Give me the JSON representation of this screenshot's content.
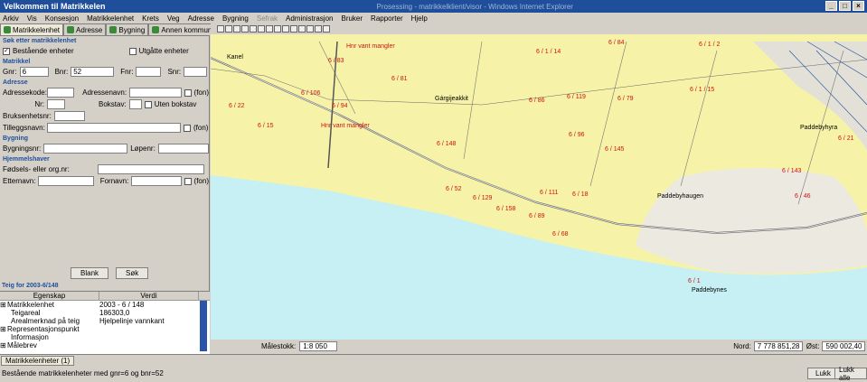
{
  "window": {
    "title": "Velkommen til Matrikkelen",
    "title_blur": "Prosessing - matrikkelklient/visor - Windows Internet Explorer"
  },
  "menu": [
    "Arkiv",
    "Vis",
    "Konsesjon",
    "Matrikkelenhet",
    "Krets",
    "Veg",
    "Adresse",
    "Bygning",
    "Sefrak",
    "Administrasjon",
    "Bruker",
    "Rapporter",
    "Hjelp"
  ],
  "tabs": [
    "Matrikkelenhet",
    "Adresse",
    "Bygning",
    "Annen kommune"
  ],
  "search": {
    "header": "Søk etter matrikkelenhet",
    "cb_existing": "Bestående enheter",
    "cb_expired": "Utgåtte enheter",
    "matrikkel_header": "Matrikkel",
    "gnr_label": "Gnr:",
    "gnr_value": "6",
    "bnr_label": "Bnr:",
    "bnr_value": "52",
    "fnr_label": "Fnr:",
    "snr_label": "Snr:",
    "adresse_header": "Adresse",
    "adressekode_label": "Adressekode:",
    "adressenavn_label": "Adressenavn:",
    "fon": "(fon)",
    "nr_label": "Nr:",
    "bokstav_label": "Bokstav:",
    "uten_bokstav": "Uten bokstav",
    "bruksenhet_label": "Bruksenhetsnr:",
    "tilleggsnavn_label": "Tilleggsnavn:",
    "bygning_header": "Bygning",
    "bygningsnr_label": "Bygningsnr:",
    "lopenr_label": "Løpenr:",
    "hjemmel_header": "Hjemmelshaver",
    "fodsel_label": "Fødsels- eller org.nr:",
    "etternavn_label": "Etternavn:",
    "fornavn_label": "Fornavn:",
    "blank_button": "Blank",
    "sok_button": "Søk"
  },
  "props": {
    "title": "Teig for 2003-6/148",
    "col1": "Egenskap",
    "col2": "Verdi",
    "rows": [
      {
        "k": "Matrikkelenhet",
        "v": "2003 - 6 / 148"
      },
      {
        "k": "Teigareal",
        "v": "186303,0"
      },
      {
        "k": "Arealmerknad på teig",
        "v": "Hjelpelinje vannkant"
      },
      {
        "k": "Representasjonspunkt",
        "v": ""
      },
      {
        "k": "Informasjon",
        "v": ""
      },
      {
        "k": "Målebrev",
        "v": ""
      }
    ]
  },
  "map": {
    "labels_red": [
      "6 / 83",
      "6 / 84",
      "6 / 1 / 14",
      "6 / 1 / 2",
      "Hnr vant mangler",
      "6 / 81",
      "6 / 106",
      "6 / 86",
      "6 / 119",
      "6 / 79",
      "6 / 1 / 15",
      "6 / 22",
      "6 / 94",
      "6 / 15",
      "Hnr vant mangler",
      "6 / 96",
      "6 / 148",
      "6 / 145",
      "6 / 21",
      "6 / 143",
      "6 / 52",
      "6 / 129",
      "6 / 111",
      "6 / 18",
      "6 / 46",
      "6 / 158",
      "6 / 89",
      "6 / 68",
      "6 / 1"
    ],
    "labels_black": [
      "Kanel",
      "Gárgijeakkit",
      "Paddebyhaugen",
      "Paddebynes",
      "Paddebyhyra"
    ],
    "scale_label": "Målestokk:",
    "scale_value": "1:8 050",
    "nord_label": "Nord:",
    "nord_value": "7 778 851,28",
    "ost_label": "Øst:",
    "ost_value": "590 002,40"
  },
  "bottom": {
    "tab": "Matrikkelenheter (1)",
    "status": "Bestående matrikkelenheter med gnr=6 og bnr=52",
    "lukk": "Lukk",
    "lukk_alle": "Lukk alle"
  }
}
